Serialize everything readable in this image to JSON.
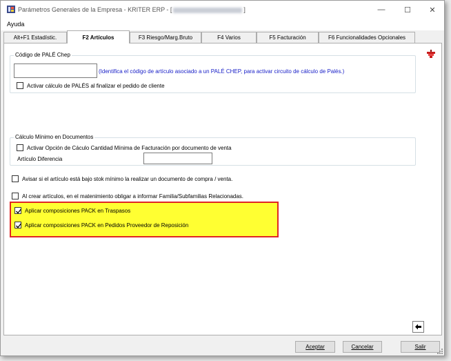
{
  "window": {
    "title": "Parámetros Generales de la Empresa - KRITER ERP - [",
    "title_suffix": "]",
    "minimize": "—",
    "maximize": "☐",
    "close": "✕"
  },
  "menu": {
    "items": [
      "Ayuda"
    ]
  },
  "tabs": [
    {
      "label": "Alt+F1 Estadístic.",
      "active": false
    },
    {
      "label": "F2 Artículos",
      "active": true
    },
    {
      "label": "F3 Riesgo/Marg.Bruto",
      "active": false
    },
    {
      "label": "F4 Varios",
      "active": false
    },
    {
      "label": "F5 Facturación",
      "active": false
    },
    {
      "label": "F6 Funcionalidades Opcionales",
      "active": false
    }
  ],
  "pale_group": {
    "legend": "Código de PALÉ Chep",
    "code_value": "",
    "hint": "(Identifica el código de artículo asociado a un PALÉ CHEP, para activar circuito de cálculo de Palés.)",
    "activate_label": "Activar cálculo de PALÉS al finalizar el pedido de cliente",
    "activate_checked": false
  },
  "minimo_group": {
    "legend": "Cálculo Mínimo en Documentos",
    "activate_label": "Activar Opción de Cáculo Cantidad Mínima de Facturación por documento de venta",
    "activate_checked": false,
    "articulo_label": "Artículo Diferencia",
    "articulo_value": ""
  },
  "options": {
    "avisar_label": "Avisar si el artículo está bajo stok mínimo la realizar un documento de compra / venta.",
    "avisar_checked": false,
    "crear_label": "Al crear artículos, en el matenimiento obligar a informar Familia/Subfamilias Relacionadas.",
    "crear_checked": false,
    "pack_traspasos_label": "Aplicar composiciones PACK en Traspasos",
    "pack_traspasos_checked": true,
    "pack_pedidos_label": "Aplicar composiciones PACK en Pedidos Proveedor de Reposición",
    "pack_pedidos_checked": true
  },
  "footer": {
    "accept": "Aceptar",
    "cancel": "Cancelar",
    "exit": "Salir"
  },
  "colors": {
    "highlight": "#ffff32",
    "highlight_border": "#e02525",
    "hint_text": "#1a21c8"
  }
}
